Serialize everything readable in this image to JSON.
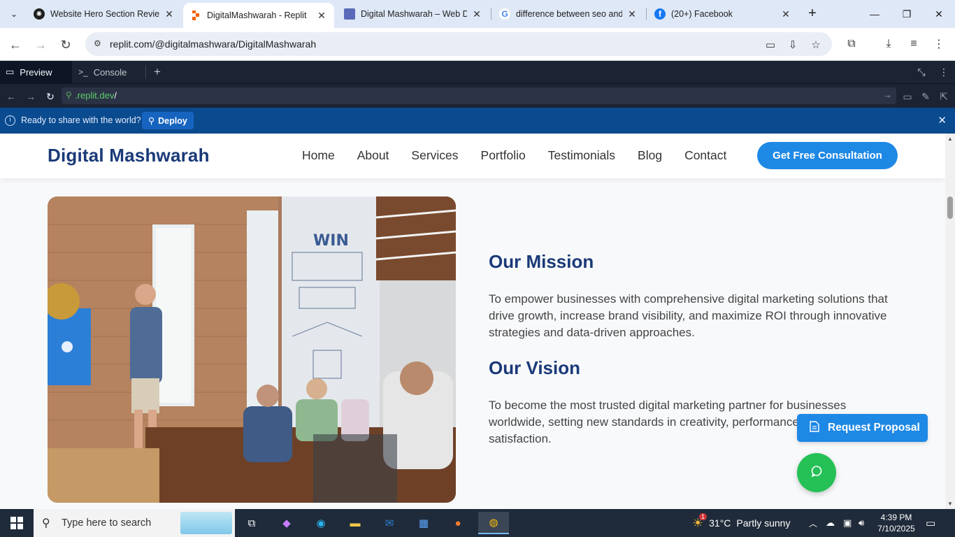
{
  "browser": {
    "tabs": [
      {
        "title": "Website Hero Section Revie",
        "favicon": "chatgpt-icon"
      },
      {
        "title": "DigitalMashwarah - Replit",
        "favicon": "replit-icon",
        "active": true
      },
      {
        "title": "Digital Mashwarah – Web D",
        "favicon": "site-icon"
      },
      {
        "title": "difference between seo and",
        "favicon": "google-icon"
      },
      {
        "title": "(20+) Facebook",
        "favicon": "facebook-icon"
      }
    ],
    "close_glyph": "✕",
    "url": "replit.com/@digitalmashwara/DigitalMashwarah"
  },
  "replit": {
    "preview_tab": "Preview",
    "console_tab": "Console",
    "preview_url_domain": ".replit.dev",
    "preview_url_path": "/",
    "deploy_message": "Ready to share with the world?",
    "deploy_label": "Deploy"
  },
  "site": {
    "brand": "Digital Mashwarah",
    "nav": [
      "Home",
      "About",
      "Services",
      "Portfolio",
      "Testimonials",
      "Blog",
      "Contact"
    ],
    "cta": "Get Free Consultation",
    "mission_title": "Our Mission",
    "mission_text": "To empower businesses with comprehensive digital marketing solutions that drive growth, increase brand visibility, and maximize ROI through innovative strategies and data-driven approaches.",
    "vision_title": "Our Vision",
    "vision_text": "To become the most trusted digital marketing partner for businesses worldwide, setting new standards in creativity, performance, and client satisfaction.",
    "proposal_button": "Request Proposal",
    "colors": {
      "brand": "#1a3a78",
      "accent": "#1e88e5",
      "whatsapp": "#25c157"
    }
  },
  "taskbar": {
    "search_placeholder": "Type here to search",
    "weather_temp": "31°C",
    "weather_desc": "Partly sunny",
    "time": "4:39 PM",
    "date": "7/10/2025",
    "weather_badge": "1"
  }
}
